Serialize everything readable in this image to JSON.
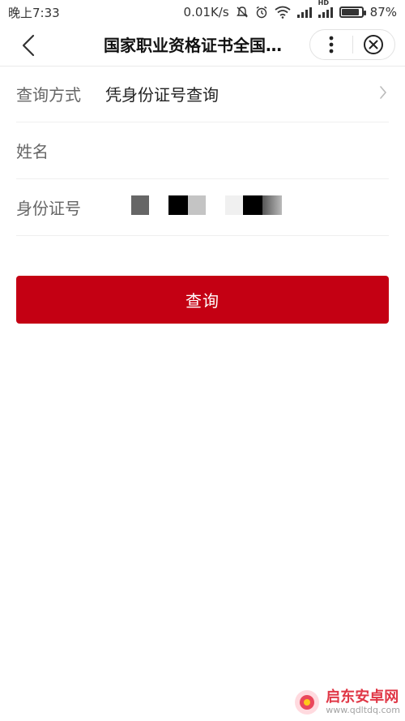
{
  "status_bar": {
    "time": "晚上7:33",
    "speed": "0.01K/s",
    "network_label": "HD",
    "battery": "87%",
    "battery_level": 0.87
  },
  "nav": {
    "title": "国家职业资格证书全国…",
    "icons": [
      "chevron-left-icon",
      "more-vertical-icon",
      "close-circle-icon"
    ]
  },
  "form": {
    "query_method_label": "查询方式",
    "query_method_value": "凭身份证号查询",
    "name_label": "姓名",
    "id_label": "身份证号"
  },
  "button": {
    "query_label": "查询"
  },
  "watermark": {
    "title": "启东安卓网",
    "url": "www.qdltdq.com"
  },
  "colors": {
    "accent": "#c40013",
    "text": "#222222",
    "label": "#666666",
    "divider": "#efefef"
  }
}
